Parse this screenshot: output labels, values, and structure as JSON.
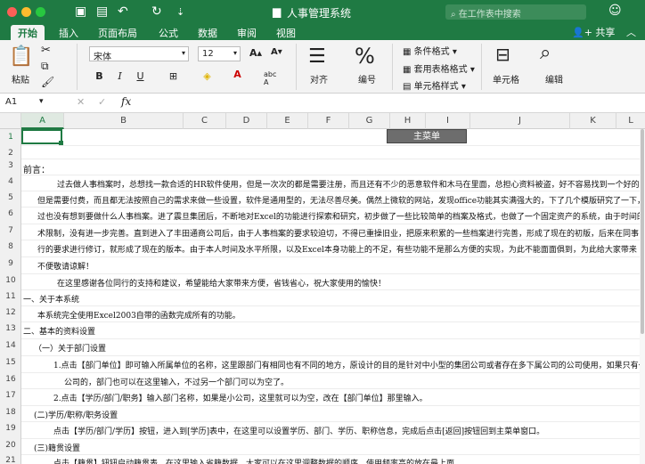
{
  "window": {
    "title": "人事管理系统",
    "search_placeholder": "在工作表中搜索"
  },
  "tabs": [
    "开始",
    "插入",
    "页面布局",
    "公式",
    "数据",
    "审阅",
    "视图"
  ],
  "share_label": "共享",
  "ribbon": {
    "paste_label": "粘贴",
    "font_name": "宋体",
    "font_size": "12",
    "align_label": "对齐",
    "number_label": "编号",
    "cond_format": "条件格式",
    "table_format": "套用表格格式",
    "cell_style": "单元格样式",
    "cells_label": "单元格",
    "edit_label": "编辑"
  },
  "formula": {
    "cell_ref": "A1",
    "fx": "fx",
    "value": ""
  },
  "columns": [
    "A",
    "B",
    "C",
    "D",
    "E",
    "F",
    "G",
    "H",
    "I",
    "J",
    "K",
    "L"
  ],
  "rows": [
    "1",
    "2",
    "3",
    "4",
    "5",
    "6",
    "7",
    "8",
    "9",
    "10",
    "11",
    "12",
    "13",
    "14",
    "15",
    "16",
    "17",
    "18",
    "19",
    "20",
    "21"
  ],
  "main_button": "主菜单",
  "content": {
    "r3": "前言：",
    "r4": "过去做人事档案时，总想找一款合适的HR软件使用，但是一次次的都是需要注册，而且还有不少的恶意软件和木马在里面，总担心资料被盗，好不容易找到一个好的，",
    "r5": "但是需要付费，而且都无法按照自己的需求来做一些设置，软件是通用型的，无法尽善尽美。偶然上微软的网站，发现office功能其实满强大的，下了几个模版研究了一下，",
    "r6": "过也没有想到要做什么人事档案。进了震旦集团后，不断地对Excel的功能进行探索和研究，初步做了一些比较简单的档案及格式，也做了一个固定资产的系统，由于时间的",
    "r7": "术限制，没有进一步完善。直到进入了丰田通商公司后，由于人事档案的要求较迫切，不得已重操旧业，把原来积累的一些档案进行完善，形成了现在的初版，后来在同事",
    "r8": "行的要求进行修订，就形成了现在的版本。由于本人时间及水平所限，以及Excel本身功能上的不足，有些功能不是那么方便的实现，为此不能面面俱到，为此给大家带来",
    "r9": "不便敬请谅解！",
    "r10": "在这里感谢各位同行的支持和建议，希望能给大家带来方便，省钱省心，祝大家使用的愉快！",
    "r11": "一、关于本系统",
    "r12": "本系统完全使用Excel2003自带的函数完成所有的功能。",
    "r13": "二、基本的资料设置",
    "r14": "（一）关于部门设置",
    "r15": "1.点击【部门单位】即可输入所属单位的名称，这里跟部门有相同也有不同的地方，原设计的目的是针对中小型的集团公司或者存在多下属公司的公司使用，如果只有一",
    "r16": "公司的，部门也可以在这里输入，不过另一个部门可以为空了。",
    "r17": "2.点击【学历/部门/职务】输入部门名称，如果是小公司，这里就可以为空，改在【部门单位】那里输入。",
    "r18": "(二)学历/职称/职务设置",
    "r19": "点击【学历/部门/学历】按钮，进入到[学历]表中，在这里可以设置学历、部门、学历、职称信息，完成后点击[返回]按钮回到主菜单窗口。",
    "r20": "(三)籍贯设置",
    "r21": "点击【籍贯】钮钮启动籍贯表，在这里输入省籍数据，大家可以在这里调整数据的顺序，使用频率高的放在最上面。"
  },
  "colors": {
    "accent": "#1f7a43",
    "close": "#fe5f57",
    "minimize": "#febc2e",
    "zoom": "#28c840"
  }
}
